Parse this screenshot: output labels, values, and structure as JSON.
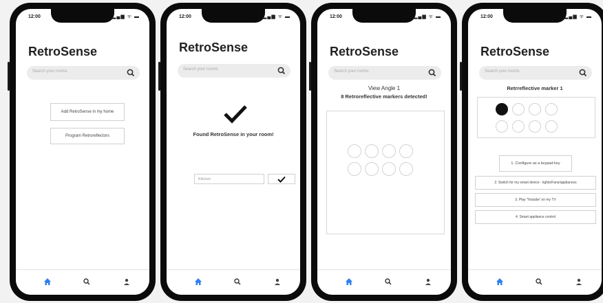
{
  "status": {
    "time": "12:00",
    "icons": "▂▄▆ ᯤ ▬"
  },
  "app_title": "RetroSense",
  "search_placeholder": "Search your rooms",
  "screen1": {
    "add_button": "Add RetroSense in my home",
    "program_button": "Program Retroreflectors"
  },
  "screen2": {
    "found_text": "Found RetroSense in your room!",
    "room_input_value": "Kitchen"
  },
  "screen3": {
    "view_angle": "View Angle 1",
    "detected": "8 Retroreflective markers detected!"
  },
  "screen4": {
    "marker_title": "Retrreflective marker 1",
    "options": [
      "1. Configure as a keypad key",
      "2. Switch for my smart device - lights/Fans/appliances",
      "3. Play 'Youtube' on my TV",
      "4. Smart appliance control"
    ]
  },
  "nav": {
    "home": "home-icon",
    "search": "search-icon",
    "profile": "user-icon"
  },
  "colors": {
    "accent": "#2f80ed",
    "marker_filled": "#111111"
  }
}
